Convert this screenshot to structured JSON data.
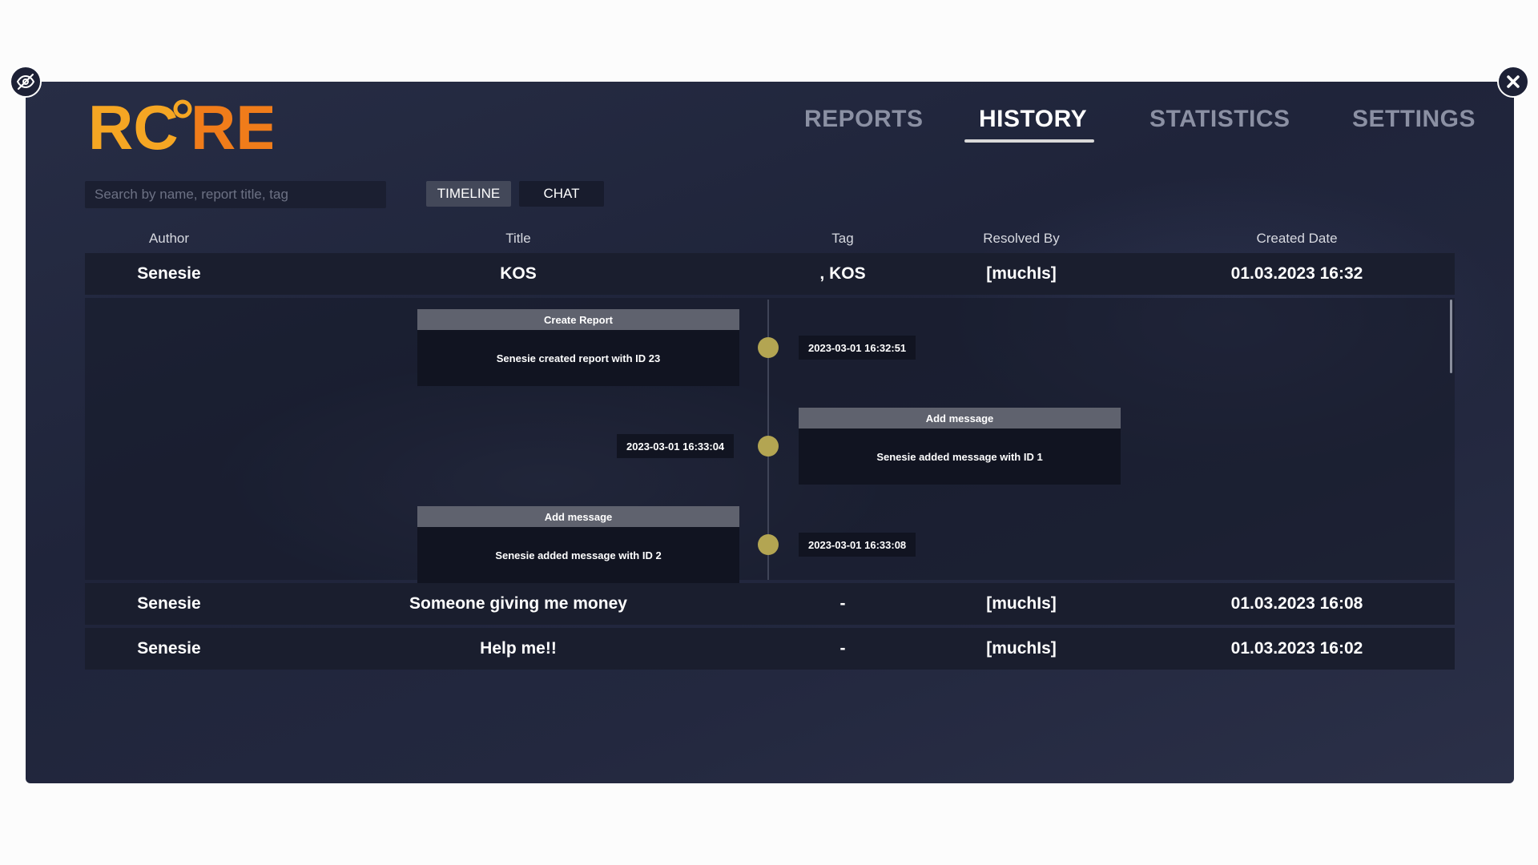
{
  "logo": {
    "text": "RCORE",
    "colors": {
      "primary": "#f5a623",
      "accent": "#f07c1a"
    }
  },
  "nav": {
    "tabs": [
      {
        "label": "REPORTS",
        "active": false
      },
      {
        "label": "HISTORY",
        "active": true
      },
      {
        "label": "STATISTICS",
        "active": false
      },
      {
        "label": "SETTINGS",
        "active": false
      }
    ]
  },
  "search": {
    "placeholder": "Search by name, report title, tag",
    "value": ""
  },
  "view_toggle": {
    "timeline_label": "TIMELINE",
    "chat_label": "CHAT",
    "selected": "TIMELINE"
  },
  "table": {
    "columns": [
      "Author",
      "Title",
      "Tag",
      "Resolved By",
      "Created Date"
    ],
    "rows": [
      {
        "author": "Senesie",
        "title": "KOS",
        "tag": ", KOS",
        "resolved_by": "[muchIs]",
        "created": "01.03.2023 16:32",
        "expanded": true
      },
      {
        "author": "Senesie",
        "title": "Someone giving me money",
        "tag": "-",
        "resolved_by": "[muchIs]",
        "created": "01.03.2023 16:08"
      },
      {
        "author": "Senesie",
        "title": "Help me!!",
        "tag": "-",
        "resolved_by": "[muchIs]",
        "created": "01.03.2023 16:02"
      }
    ]
  },
  "timeline": {
    "events": [
      {
        "title": "Create Report",
        "text": "Senesie created report with ID 23",
        "timestamp": "2023-03-01 16:32:51",
        "side": "left"
      },
      {
        "title": "Add message",
        "text": "Senesie added message with ID 1",
        "timestamp": "2023-03-01 16:33:04",
        "side": "right"
      },
      {
        "title": "Add message",
        "text": "Senesie added message with ID 2",
        "timestamp": "2023-03-01 16:33:08",
        "side": "left"
      }
    ],
    "dot_color": "#b3a552"
  },
  "icons": {
    "hide": "eye-slash-icon",
    "close": "close-icon"
  }
}
